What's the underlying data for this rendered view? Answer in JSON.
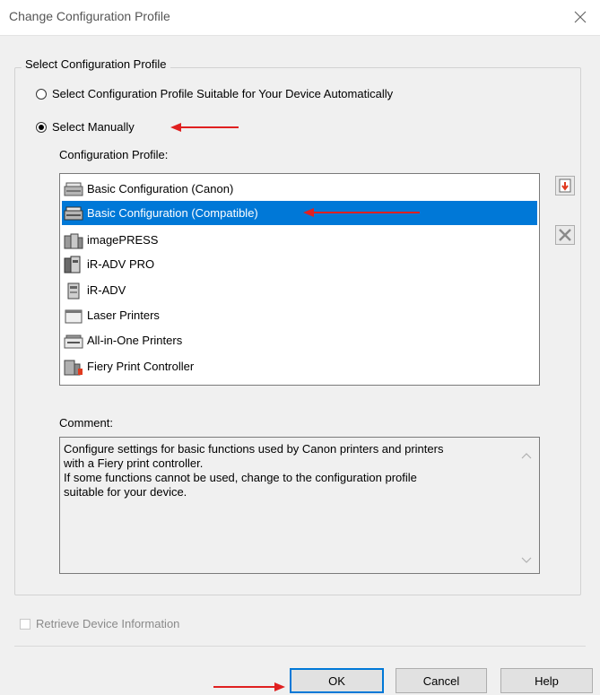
{
  "window": {
    "title": "Change Configuration Profile",
    "close_glyph": "✕"
  },
  "group": {
    "legend": "Select Configuration Profile",
    "radio_auto_label": "Select Configuration Profile Suitable for Your Device Automatically",
    "radio_manual_label": "Select Manually",
    "selected_option": "manual"
  },
  "profile_list": {
    "label": "Configuration Profile:",
    "items": [
      {
        "label": "Basic Configuration (Canon)",
        "icon": "copier-icon",
        "selected": false
      },
      {
        "label": "Basic Configuration (Compatible)",
        "icon": "copier-icon",
        "selected": true
      },
      {
        "label": "imagePRESS",
        "icon": "production-press-icon",
        "selected": false
      },
      {
        "label": "iR-ADV PRO",
        "icon": "multifunction-printer-icon",
        "selected": false
      },
      {
        "label": "iR-ADV",
        "icon": "multifunction-printer-icon",
        "selected": false
      },
      {
        "label": "Laser Printers",
        "icon": "laser-printer-icon",
        "selected": false
      },
      {
        "label": "All-in-One Printers",
        "icon": "all-in-one-printer-icon",
        "selected": false
      },
      {
        "label": "Fiery Print Controller",
        "icon": "fiery-controller-icon",
        "selected": false
      }
    ]
  },
  "side_buttons": {
    "import_icon": "import-profile-icon",
    "delete_icon": "delete-profile-icon"
  },
  "comment": {
    "label": "Comment:",
    "text": "Configure settings for basic functions used by Canon printers and printers\nwith a Fiery print controller.\nIf some functions cannot be used, change to the configuration profile\nsuitable for your device."
  },
  "retrieve": {
    "label": "Retrieve Device Information",
    "checked": false,
    "enabled": false
  },
  "buttons": {
    "ok": "OK",
    "cancel": "Cancel",
    "help": "Help"
  },
  "colors": {
    "selection": "#0078d7",
    "annotation_arrow": "#e02020"
  }
}
